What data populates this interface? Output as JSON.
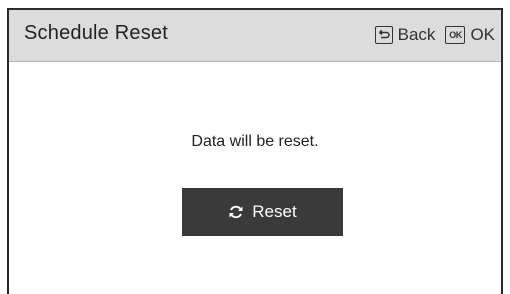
{
  "header": {
    "title": "Schedule Reset",
    "back_label": "Back",
    "ok_icon_text": "OK",
    "ok_label": "OK"
  },
  "main": {
    "message": "Data will be reset.",
    "reset_button_label": "Reset"
  },
  "icons": {
    "back": "back-arrow-icon",
    "ok": "ok-key-icon",
    "reset": "refresh-icon"
  },
  "colors": {
    "header_bg": "#dcdcdc",
    "button_bg": "#3a3a3a",
    "button_text": "#ffffff",
    "text": "#222222"
  }
}
